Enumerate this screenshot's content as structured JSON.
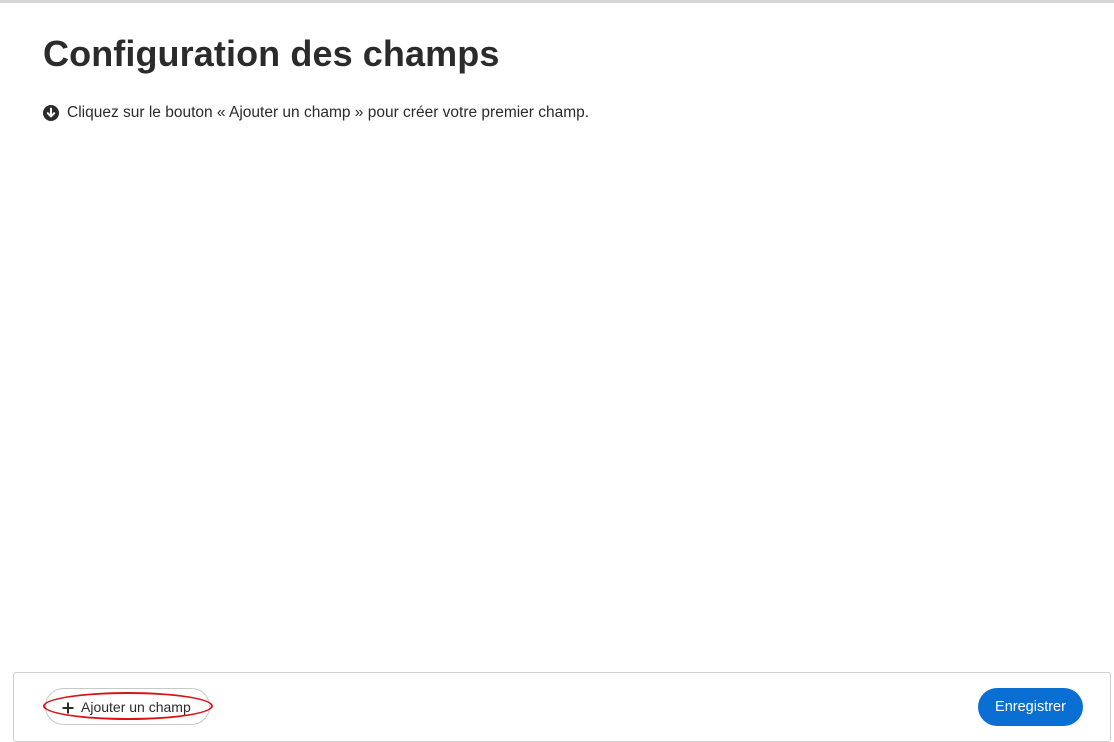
{
  "page": {
    "title": "Configuration des champs",
    "hint": {
      "icon": "arrow-down-circle-icon",
      "text": "Cliquez sur le bouton « Ajouter un champ » pour créer votre premier champ."
    }
  },
  "footer": {
    "add_button": {
      "icon": "plus-icon",
      "label": "Ajouter un champ",
      "annotation_color": "#d8141b"
    },
    "save_button": {
      "label": "Enregistrer",
      "color": "#0a6fd3"
    }
  }
}
